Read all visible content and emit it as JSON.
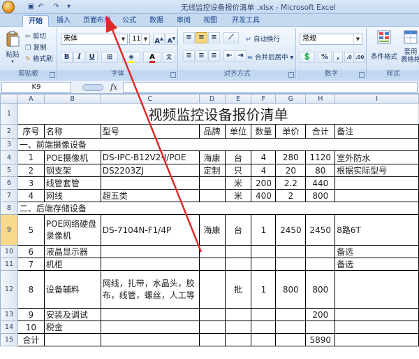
{
  "window": {
    "title": "无线监控设备报价清单 .xlsx - Microsoft Excel"
  },
  "ribbon": {
    "tabs": [
      "开始",
      "插入",
      "页面布局",
      "公式",
      "数据",
      "审阅",
      "视图",
      "开发工具"
    ],
    "clipboard": {
      "label": "剪贴板",
      "paste": "粘贴",
      "cut": "剪切",
      "copy": "复制",
      "format_painter": "格式刷"
    },
    "font": {
      "label": "字体",
      "name": "宋体",
      "size": "11"
    },
    "alignment": {
      "label": "对齐方式",
      "wrap": "自动换行",
      "merge": "合并后居中"
    },
    "number": {
      "label": "数字",
      "format": "常规"
    },
    "styles": {
      "label": "样式",
      "conditional": "条件格式",
      "table": "套用\n表格格式"
    }
  },
  "formula_bar": {
    "name_box": "K9",
    "fx": "fx",
    "value": ""
  },
  "sheet": {
    "columns": [
      "A",
      "B",
      "C",
      "D",
      "E",
      "F",
      "G",
      "H",
      "I"
    ],
    "rows": [
      {
        "n": "1",
        "title": "视频监控设备报价清单"
      },
      {
        "n": "2",
        "cells": [
          "序号",
          "名称",
          "型号",
          "品牌",
          "单位",
          "数量",
          "单价",
          "合计",
          "备注"
        ]
      },
      {
        "n": "3",
        "section": "一、前端摄像设备"
      },
      {
        "n": "4",
        "cells": [
          "1",
          "POE摄像机",
          "DS-IPC-B12V2-I/POE",
          "海康",
          "台",
          "4",
          "280",
          "1120",
          "室外防水"
        ]
      },
      {
        "n": "5",
        "cells": [
          "2",
          "钢支架",
          "DS2203ZJ",
          "定制",
          "只",
          "4",
          "20",
          "80",
          "根据实际型号"
        ]
      },
      {
        "n": "6",
        "cells": [
          "3",
          "线管套管",
          "",
          "",
          "米",
          "200",
          "2.2",
          "440",
          ""
        ]
      },
      {
        "n": "7",
        "cells": [
          "4",
          "网线",
          "超五类",
          "",
          "米",
          "400",
          "2",
          "800",
          ""
        ]
      },
      {
        "n": "8",
        "section": "二、后端存储设备"
      },
      {
        "n": "9",
        "cells": [
          "5",
          "POE网络硬盘录像机",
          "DS-7104N-F1/4P",
          "海康",
          "台",
          "1",
          "2450",
          "2450",
          "8路6T"
        ]
      },
      {
        "n": "10",
        "cells": [
          "6",
          "液晶显示器",
          "",
          "",
          "",
          "",
          "",
          "",
          "备选"
        ]
      },
      {
        "n": "11",
        "cells": [
          "7",
          "机柜",
          "",
          "",
          "",
          "",
          "",
          "",
          "备选"
        ]
      },
      {
        "n": "12",
        "cells": [
          "8",
          "设备辅料",
          "网线，扎带，水晶头，胶布，线管，螺丝，人工等",
          "",
          "批",
          "1",
          "800",
          "800",
          ""
        ]
      },
      {
        "n": "13",
        "cells": [
          "9",
          "安装及调试",
          "",
          "",
          "",
          "",
          "",
          "200",
          ""
        ]
      },
      {
        "n": "14",
        "cells": [
          "10",
          "税金",
          "",
          "",
          "",
          "",
          "",
          "",
          ""
        ]
      },
      {
        "n": "15",
        "cells": [
          "合计",
          "",
          "",
          "",
          "",
          "",
          "",
          "5890",
          ""
        ]
      }
    ]
  },
  "annotation": {
    "arrow_color": "#e02a2a"
  }
}
